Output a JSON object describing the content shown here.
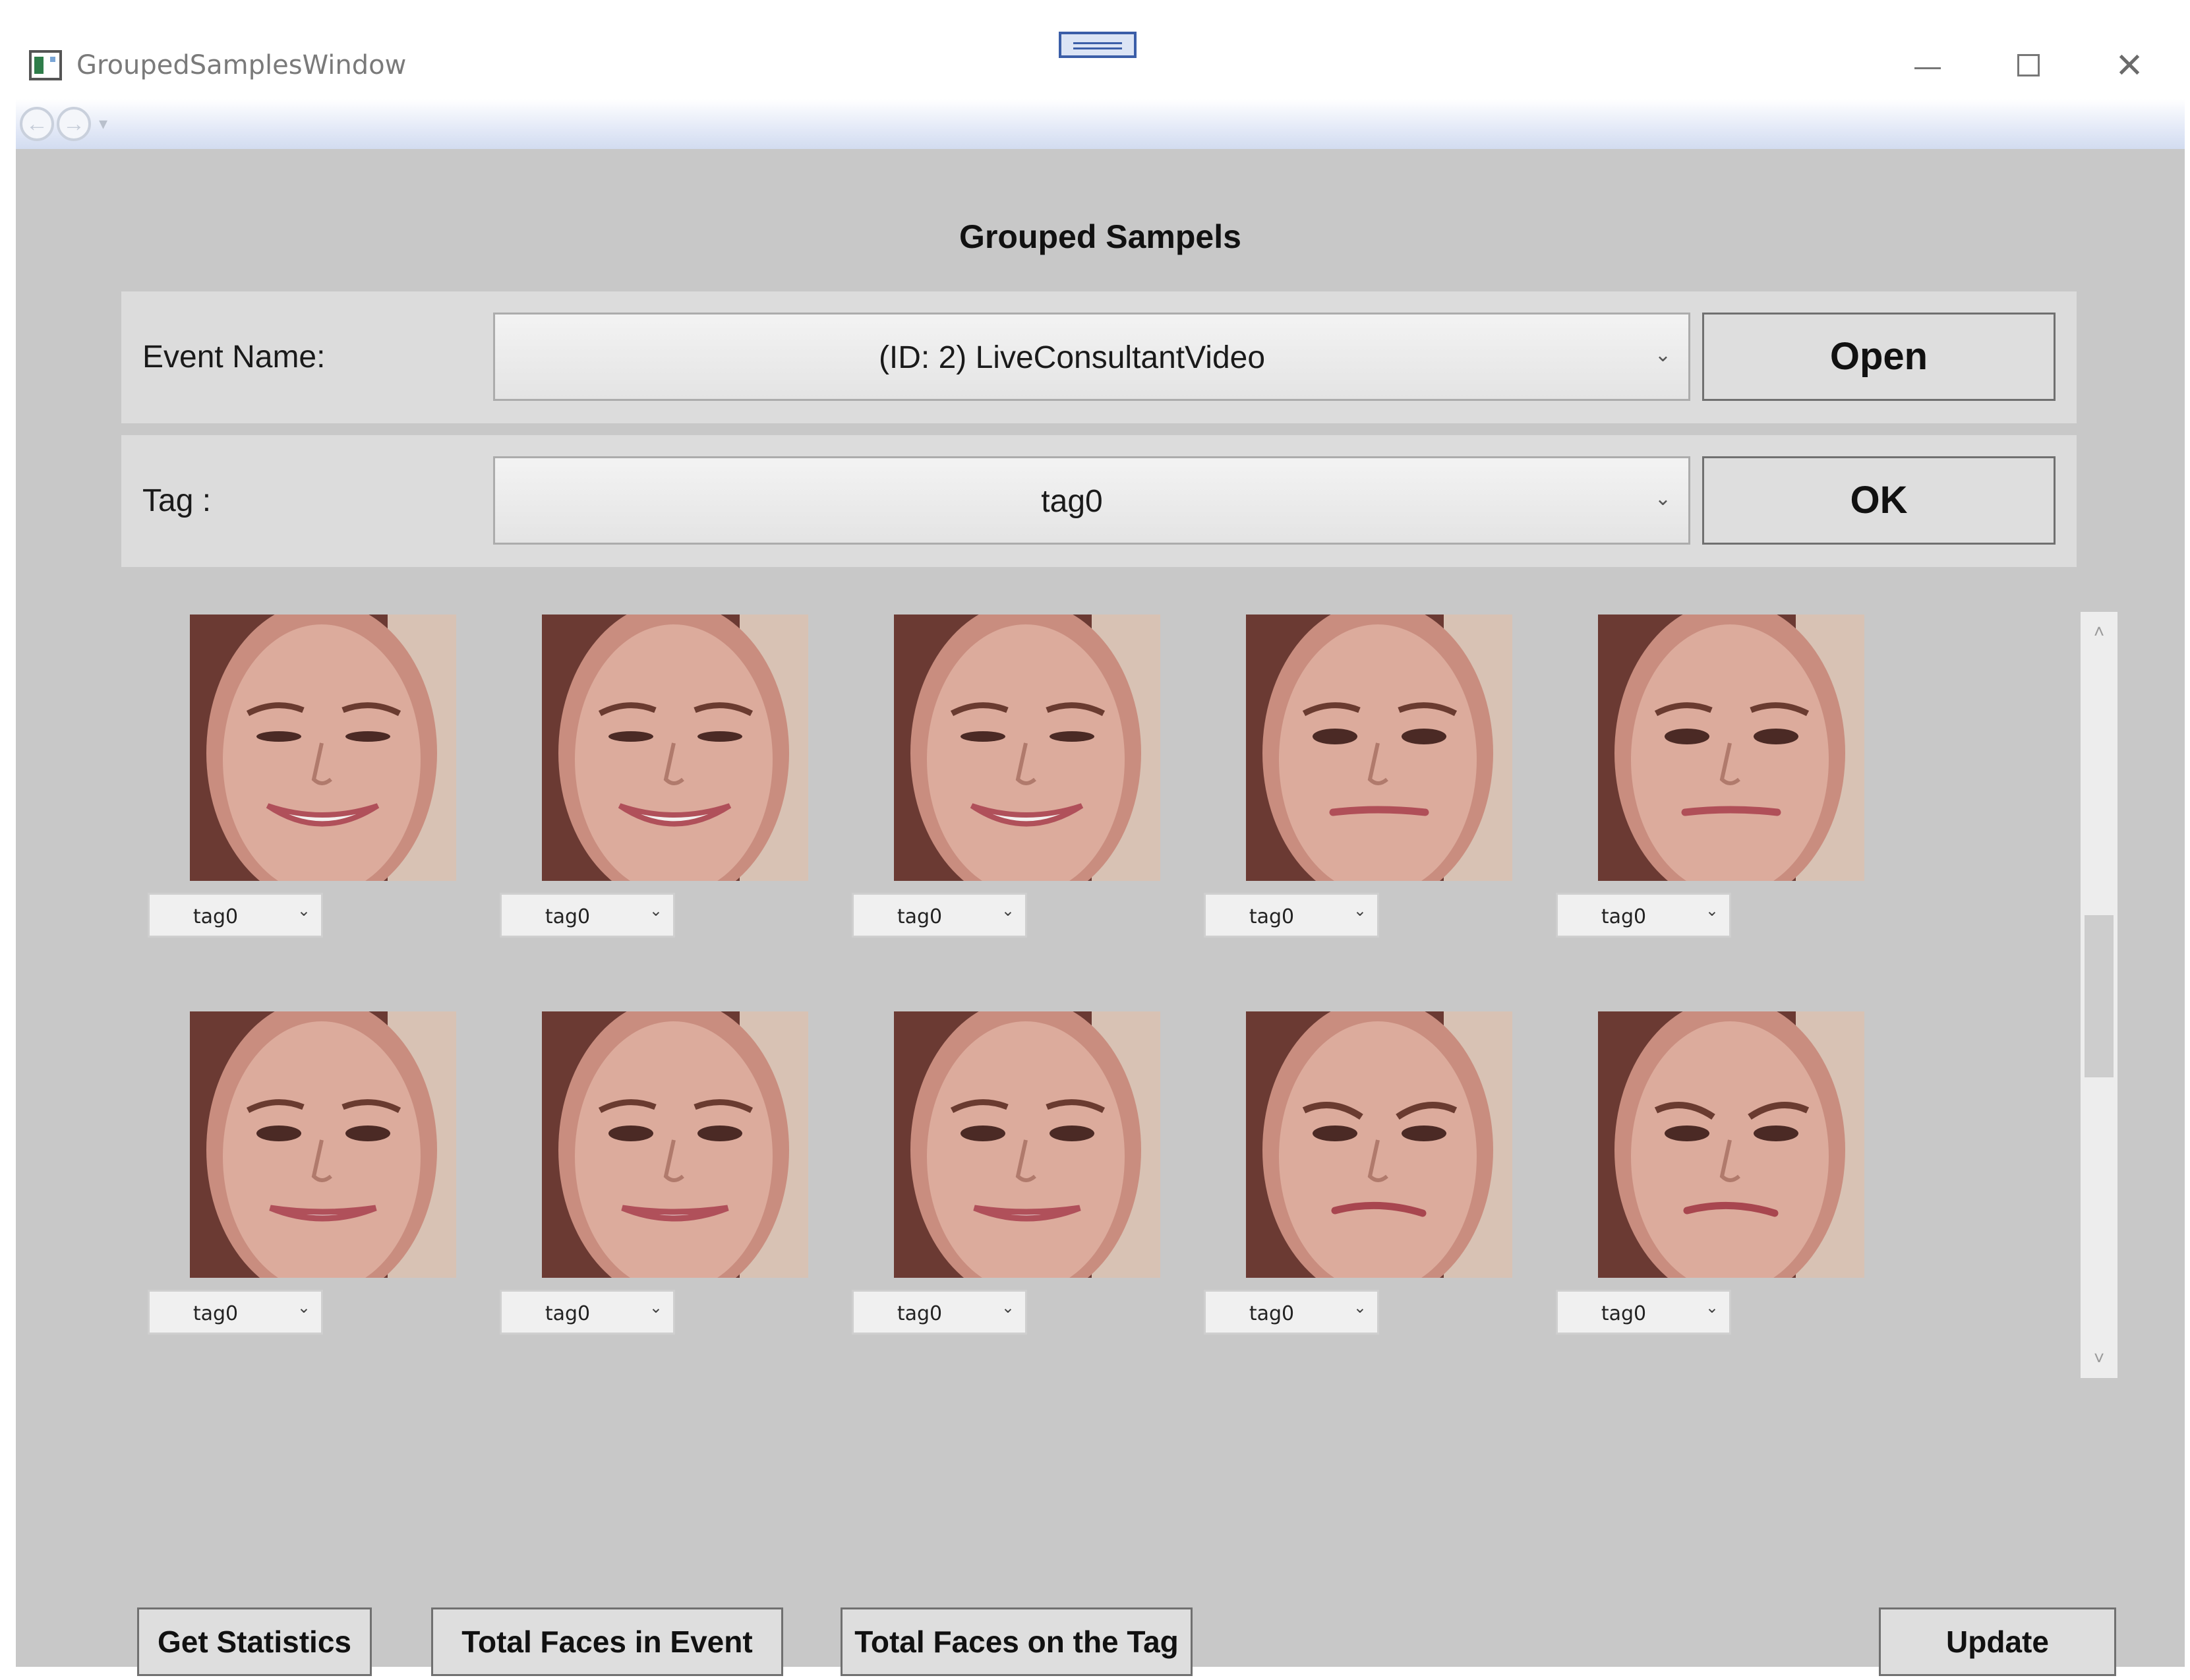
{
  "window": {
    "title": "GroupedSamplesWindow",
    "minimize_symbol": "—",
    "close_symbol": "✕"
  },
  "nav": {
    "back": "←",
    "forward": "→",
    "dropdown": "▾"
  },
  "page": {
    "heading": "Grouped Sampels"
  },
  "event_row": {
    "label": "Event Name:",
    "selected": "(ID: 2) LiveConsultantVideo",
    "button": "Open"
  },
  "tag_row": {
    "label": "Tag :",
    "selected": "tag0",
    "button": "OK"
  },
  "samples": [
    {
      "tag": "tag0",
      "expression": "smile"
    },
    {
      "tag": "tag0",
      "expression": "smile"
    },
    {
      "tag": "tag0",
      "expression": "smile"
    },
    {
      "tag": "tag0",
      "expression": "neutral"
    },
    {
      "tag": "tag0",
      "expression": "neutral"
    },
    {
      "tag": "tag0",
      "expression": "talk"
    },
    {
      "tag": "tag0",
      "expression": "talk"
    },
    {
      "tag": "tag0",
      "expression": "talk"
    },
    {
      "tag": "tag0",
      "expression": "frown"
    },
    {
      "tag": "tag0",
      "expression": "frown"
    }
  ],
  "scroll": {
    "up": "˄",
    "down": "˅"
  },
  "combo_arrow": "⌄",
  "bottom_buttons": {
    "statistics": "Get Statistics",
    "faces_in_event": "Total Faces in Event",
    "faces_on_tag": "Total Faces on the Tag",
    "update": "Update"
  },
  "colors": {
    "client_bg": "#c8c8c8",
    "panel_bg": "#dcdcdc",
    "button_bg": "#dedede"
  }
}
